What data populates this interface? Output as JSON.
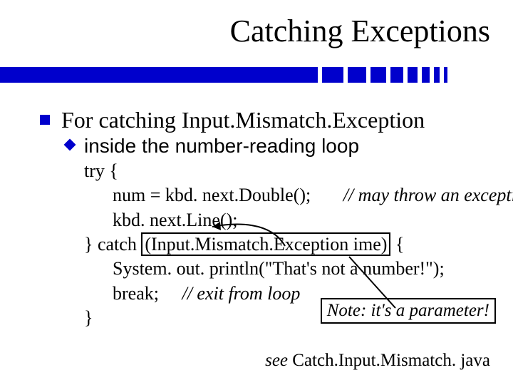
{
  "title": "Catching Exceptions",
  "bullet1": "For catching Input.Mismatch.Exception",
  "bullet2": "inside the number-reading loop",
  "code": {
    "l1": "try {",
    "l2a": "num = kbd. next.Double();",
    "l2b": "// may throw an exception",
    "l3": "kbd. next.Line();",
    "l4a": "} catch ",
    "l4b": "(Input.Mismatch.Exception ime)",
    "l4c": " {",
    "l5": "System. out. println(\"That's not a number!\");",
    "l6a": "break;",
    "l6b": "// exit from loop",
    "l7": "}"
  },
  "note": {
    "label": "Note",
    "text": ": it's a parameter!"
  },
  "see": {
    "word": "see",
    "file": " Catch.Input.Mismatch. java"
  }
}
